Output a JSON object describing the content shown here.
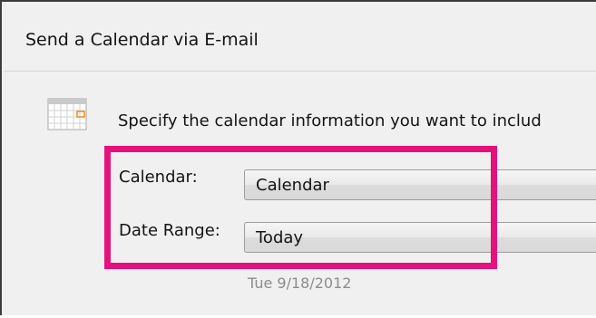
{
  "window": {
    "title": "Send a Calendar via E-mail"
  },
  "dialog": {
    "icon": "calendar-grid-icon",
    "instruction": "Specify the calendar information you want to includ",
    "calendar_label": "Calendar:",
    "calendar_value": "Calendar",
    "date_range_label": "Date Range:",
    "date_range_value": "Today",
    "date_note": "Tue 9/18/2012"
  },
  "colors": {
    "highlight": "#e5127c",
    "dialog_bg": "#f0f0f0",
    "text": "#141414",
    "muted_text": "#8c8c8c"
  }
}
